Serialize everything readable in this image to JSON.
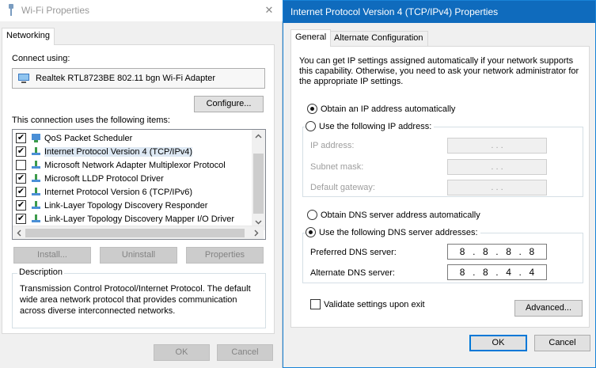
{
  "wifi": {
    "title": "Wi-Fi Properties",
    "tab": "Networking",
    "connect_using_label": "Connect using:",
    "adapter_name": "Realtek RTL8723BE 802.11 bgn Wi-Fi Adapter",
    "configure_button": "Configure...",
    "items_label": "This connection uses the following items:",
    "items": [
      {
        "label": "QoS Packet Scheduler",
        "checked": true,
        "icon": "qos-scheduler-icon"
      },
      {
        "label": "Internet Protocol Version 4 (TCP/IPv4)",
        "checked": true,
        "icon": "protocol-icon"
      },
      {
        "label": "Microsoft Network Adapter Multiplexor Protocol",
        "checked": false,
        "icon": "protocol-icon"
      },
      {
        "label": "Microsoft LLDP Protocol Driver",
        "checked": true,
        "icon": "protocol-icon"
      },
      {
        "label": "Internet Protocol Version 6 (TCP/IPv6)",
        "checked": true,
        "icon": "protocol-icon"
      },
      {
        "label": "Link-Layer Topology Discovery Responder",
        "checked": true,
        "icon": "protocol-icon"
      },
      {
        "label": "Link-Layer Topology Discovery Mapper I/O Driver",
        "checked": true,
        "icon": "protocol-icon"
      }
    ],
    "install_button": "Install...",
    "uninstall_button": "Uninstall",
    "properties_button": "Properties",
    "description_legend": "Description",
    "description_text": "Transmission Control Protocol/Internet Protocol. The default wide area network protocol that provides communication across diverse interconnected networks.",
    "ok_button": "OK",
    "cancel_button": "Cancel"
  },
  "ipv4": {
    "title": "Internet Protocol Version 4 (TCP/IPv4) Properties",
    "tabs": [
      "General",
      "Alternate Configuration"
    ],
    "intro": "You can get IP settings assigned automatically if your network supports this capability. Otherwise, you need to ask your network administrator for the appropriate IP settings.",
    "obtain_ip_auto": "Obtain an IP address automatically",
    "use_following_ip": "Use the following IP address:",
    "ip_address_label": "IP address:",
    "subnet_mask_label": "Subnet mask:",
    "default_gateway_label": "Default gateway:",
    "empty_ip": ".     .     .",
    "obtain_dns_auto": "Obtain DNS server address automatically",
    "use_following_dns": "Use the following DNS server addresses:",
    "preferred_dns_label": "Preferred DNS server:",
    "alternate_dns_label": "Alternate DNS server:",
    "preferred_dns": [
      "8",
      "8",
      "8",
      "8"
    ],
    "alternate_dns": [
      "8",
      "8",
      "4",
      "4"
    ],
    "validate_label": "Validate settings upon exit",
    "advanced_button": "Advanced...",
    "ok_button": "OK",
    "cancel_button": "Cancel"
  }
}
